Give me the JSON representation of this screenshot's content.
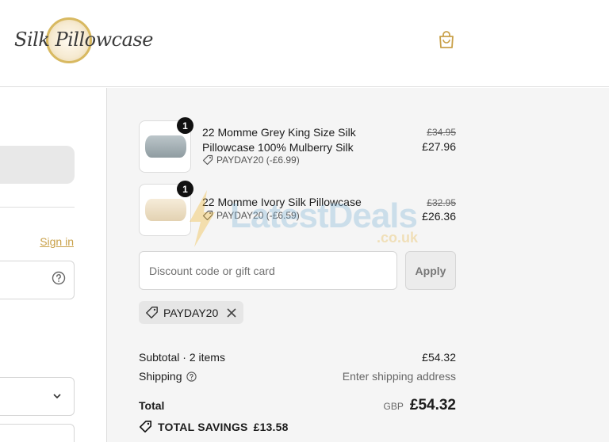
{
  "header": {
    "logo_text": "Silk Pillowcase",
    "cart_icon": "shopping-bag-icon",
    "accent_color": "#c9a14a"
  },
  "left": {
    "signin_label": "Sign in",
    "help_icon": "question-circle-icon",
    "chevron_icon": "chevron-down-icon"
  },
  "order_summary": {
    "items": [
      {
        "quantity": "1",
        "title": "22 Momme Grey King Size Silk Pillowcase 100% Mulberry Silk",
        "discount": "PAYDAY20 (-£6.99)",
        "original_price": "£34.95",
        "price": "£27.96",
        "color": "#a9b4b8"
      },
      {
        "quantity": "1",
        "title": "22 Momme Ivory Silk Pillowcase",
        "discount": "PAYDAY20 (-£6.59)",
        "original_price": "£32.95",
        "price": "£26.36",
        "color": "#efe3cc"
      }
    ],
    "discount_placeholder": "Discount code or gift card",
    "apply_label": "Apply",
    "applied_code": "PAYDAY20",
    "subtotal_label": "Subtotal · 2 items",
    "subtotal_value": "£54.32",
    "shipping_label": "Shipping",
    "shipping_value": "Enter shipping address",
    "total_label": "Total",
    "currency": "GBP",
    "total_value": "£54.32",
    "savings_label": "TOTAL SAVINGS",
    "savings_value": "£13.58"
  },
  "watermark": {
    "text": "LatestDeals",
    "sub": ".co.uk"
  }
}
